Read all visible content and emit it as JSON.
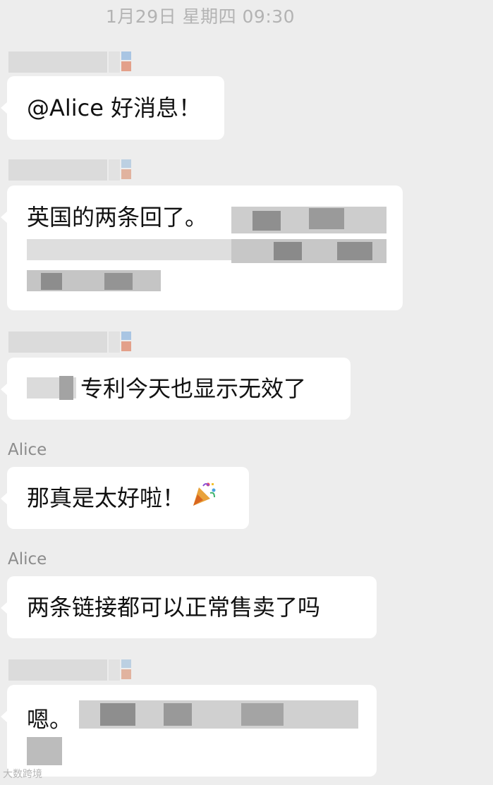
{
  "timestamp": "1月29日 星期四 09:30",
  "messages": [
    {
      "sender": "",
      "text": "@Alice 好消息！"
    },
    {
      "sender": "",
      "text": "英国的两条回了。"
    },
    {
      "sender": "",
      "text": "专利今天也显示无效了"
    },
    {
      "sender": "Alice",
      "text": "那真是太好啦！",
      "emoji": "party-popper-icon"
    },
    {
      "sender": "Alice",
      "text": "两条链接都可以正常售卖了吗"
    },
    {
      "sender": "",
      "text": "嗯。"
    }
  ],
  "watermark": "大数跨境",
  "colors": {
    "background": "#ededed",
    "bubble": "#ffffff",
    "timestamp": "#b3b3b3",
    "sender": "#8c8c8c"
  }
}
